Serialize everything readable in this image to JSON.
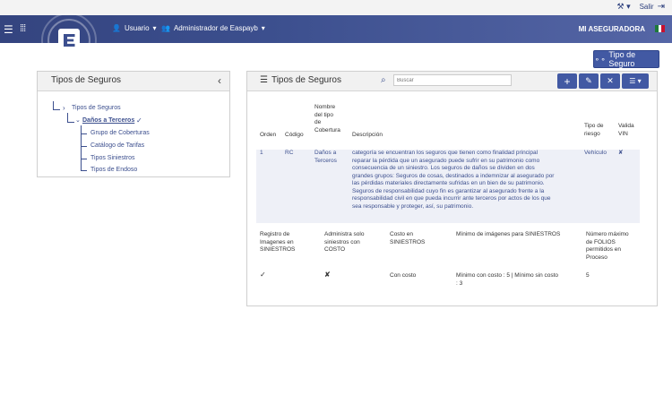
{
  "topbar": {
    "tool_icon": "tools-icon",
    "logout_label": "Salir"
  },
  "navbar": {
    "user_label": "Usuario",
    "admin_label": "Administrador de Easpayb",
    "brand": "MI ASEGURADORA"
  },
  "actions": {
    "tipo_seguro_button": "Tipo de Seguro"
  },
  "left_panel": {
    "title": "Tipos de Seguros",
    "tree": {
      "root": "Tipos de Seguros",
      "child": "Daños a Terceros",
      "leaves": [
        "Grupo de Coberturas",
        "Catálogo de Tarifas",
        "Tipos Siniestros",
        "Tipos de Endoso"
      ]
    }
  },
  "right_panel": {
    "title": "Tipos de Seguros",
    "search_placeholder": "Buscar",
    "columns": {
      "orden": "Orden",
      "codigo": "Código",
      "nombre": [
        "Nombre",
        "del tipo",
        "de",
        "Cobertura"
      ],
      "descripcion": "Descripción",
      "tipo_riesgo": [
        "Tipo de",
        "riesgo"
      ],
      "valida_vin": [
        "Valida",
        "VIN"
      ]
    },
    "row": {
      "orden": "1",
      "codigo": "RC",
      "nombre": [
        "Daños a",
        "Terceros"
      ],
      "descripcion": [
        "categoría se encuentran los seguros que tienen como finalidad principal",
        "reparar la pérdida que un asegurado puede sufrir en su patrimonio como",
        "consecuencia de un siniestro. Los seguros de daños se dividen en dos",
        "grandes grupos: Seguros de cosas, destinados a indemnizar al asegurado por",
        "las pérdidas materiales directamente sufridas en un bien de su patrimonio.",
        "Seguros de responsabilidad cuyo fin es garantizar al asegurado frente a la",
        "responsabilidad civil en que pueda incurrir ante terceros por actos de los que",
        "sea responsable y proteger, así, su patrimonio."
      ],
      "tipo_riesgo": "Vehículo",
      "valida_vin": "✘"
    },
    "details": {
      "headers": {
        "registro": [
          "Registro de",
          "Imagenes en",
          "SINIESTROS"
        ],
        "administra": [
          "Administra solo",
          "siniestros con",
          "COSTO"
        ],
        "costo": [
          "Costo en",
          "SINIESTROS"
        ],
        "minimo": "Mínimo de imágenes para SINIESTROS",
        "folios": [
          "Número máximo",
          "de FOLIOS",
          "permitidos en",
          "Proceso"
        ]
      },
      "values": {
        "registro": "✓",
        "administra": "✘",
        "costo": "Con costo",
        "minimo": [
          "Mínimo con costo : 5 | Mínimo sin costo",
          ": 3"
        ],
        "folios": "5"
      }
    }
  },
  "colors": {
    "primary": "#4259a3",
    "navbar": "#3c4f8e"
  }
}
